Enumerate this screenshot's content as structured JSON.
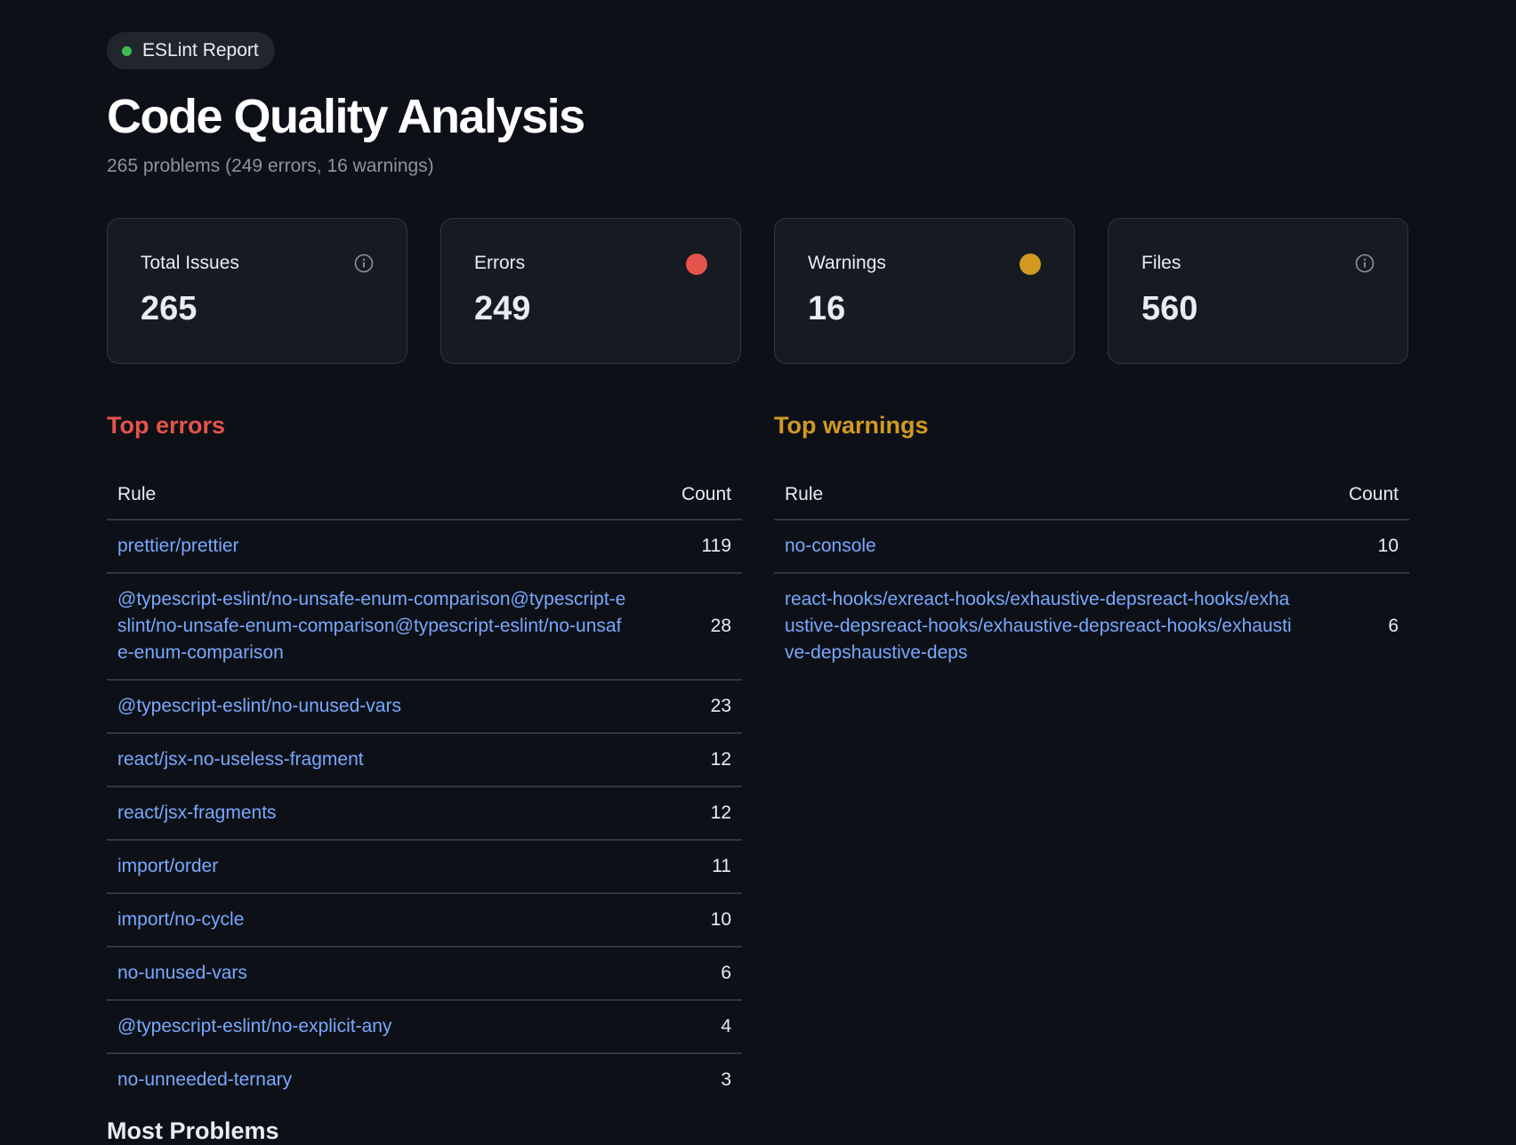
{
  "badge": {
    "label": "ESLint Report",
    "dot_color": "#3fb950"
  },
  "title": "Code Quality Analysis",
  "subtitle": "265 problems (249 errors, 16 warnings)",
  "cards": [
    {
      "label": "Total Issues",
      "value": "265",
      "icon": "info-icon"
    },
    {
      "label": "Errors",
      "value": "249",
      "icon": "status-dot",
      "color": "#e5534b"
    },
    {
      "label": "Warnings",
      "value": "16",
      "icon": "status-dot",
      "color": "#d29922"
    },
    {
      "label": "Files",
      "value": "560",
      "icon": "info-icon"
    }
  ],
  "errors": {
    "title": "Top errors",
    "color": "#e5534b",
    "headers": {
      "rule": "Rule",
      "count": "Count"
    },
    "rows": [
      {
        "rule": "prettier/prettier",
        "count": "119"
      },
      {
        "rule": "@typescript-eslint/no-unsafe-enum-comparison@typescript-eslint/no-unsafe-enum-comparison@typescript-eslint/no-unsafe-enum-comparison",
        "count": "28"
      },
      {
        "rule": "@typescript-eslint/no-unused-vars",
        "count": "23"
      },
      {
        "rule": "react/jsx-no-useless-fragment",
        "count": "12"
      },
      {
        "rule": "react/jsx-fragments",
        "count": "12"
      },
      {
        "rule": "import/order",
        "count": "11"
      },
      {
        "rule": "import/no-cycle",
        "count": "10"
      },
      {
        "rule": "no-unused-vars",
        "count": "6"
      },
      {
        "rule": "@typescript-eslint/no-explicit-any",
        "count": "4"
      },
      {
        "rule": "no-unneeded-ternary",
        "count": "3"
      }
    ]
  },
  "warnings": {
    "title": "Top warnings",
    "color": "#d29922",
    "headers": {
      "rule": "Rule",
      "count": "Count"
    },
    "rows": [
      {
        "rule": "no-console",
        "count": "10"
      },
      {
        "rule": "react-hooks/exreact-hooks/exhaustive-depsreact-hooks/exhaustive-depsreact-hooks/exhaustive-depsreact-hooks/exhaustive-depshaustive-deps",
        "count": "6"
      }
    ]
  },
  "next_section": {
    "title": "Most Problems"
  }
}
